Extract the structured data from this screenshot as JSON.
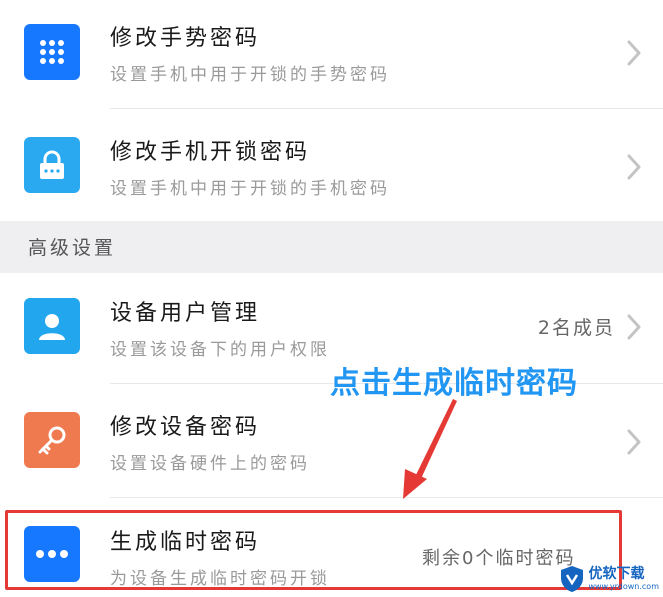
{
  "items": [
    {
      "title": "修改手势密码",
      "subtitle": "设置手机中用于开锁的手势密码",
      "icon": "keypad-icon",
      "icon_color": "#1677ff"
    },
    {
      "title": "修改手机开锁密码",
      "subtitle": "设置手机中用于开锁的手机密码",
      "icon": "lock-icon",
      "icon_color": "#2aa9f0"
    }
  ],
  "section": {
    "label": "高级设置"
  },
  "advanced_items": [
    {
      "title": "设备用户管理",
      "subtitle": "设置该设备下的用户权限",
      "right_text": "2名成员",
      "icon": "user-icon",
      "icon_color": "#22a7ee"
    },
    {
      "title": "修改设备密码",
      "subtitle": "设置设备硬件上的密码",
      "icon": "key-icon",
      "icon_color": "#f07a4f"
    },
    {
      "title": "生成临时密码",
      "subtitle": "为设备生成临时密码开锁",
      "right_text": "剩余0个临时密码",
      "icon": "more-dots-icon",
      "icon_color": "#1677ff"
    }
  ],
  "annotation": {
    "text": "点击生成临时密码",
    "color": "#2196f3",
    "highlight_color": "#e53935"
  },
  "watermark": {
    "text": "优软下载",
    "sub": "www.yrdown.com"
  }
}
